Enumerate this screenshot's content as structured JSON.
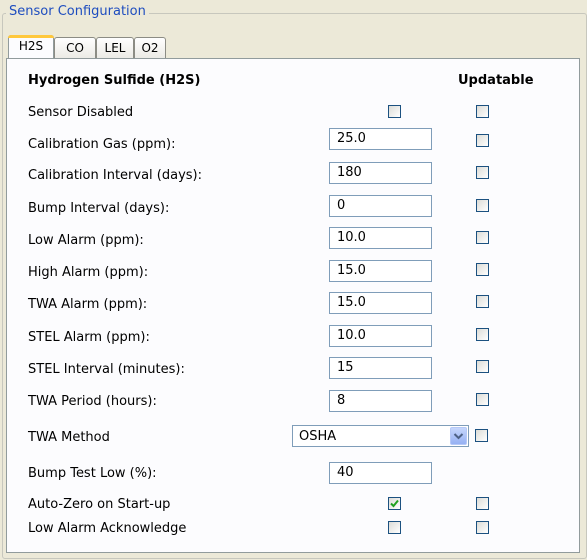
{
  "group": {
    "title": "Sensor Configuration"
  },
  "tabs": [
    "H2S",
    "CO",
    "LEL",
    "O2"
  ],
  "section": {
    "title": "Hydrogen Sulfide (H2S)",
    "updatable_header": "Updatable"
  },
  "rows": [
    {
      "label": "Sensor Disabled"
    },
    {
      "label": "Calibration Gas (ppm):",
      "value": "25.0"
    },
    {
      "label": "Calibration Interval (days):",
      "value": "180"
    },
    {
      "label": "Bump Interval (days):",
      "value": "0"
    },
    {
      "label": "Low Alarm (ppm):",
      "value": "10.0"
    },
    {
      "label": "High Alarm (ppm):",
      "value": "15.0"
    },
    {
      "label": "TWA Alarm (ppm):",
      "value": "15.0"
    },
    {
      "label": "STEL Alarm (ppm):",
      "value": "10.0"
    },
    {
      "label": "STEL Interval (minutes):",
      "value": "15"
    },
    {
      "label": "TWA Period (hours):",
      "value": "8"
    },
    {
      "label": "TWA Method",
      "value": "OSHA"
    },
    {
      "label": "Bump Test Low (%):",
      "value": "40"
    },
    {
      "label": "Auto-Zero on Start-up",
      "checked": true
    },
    {
      "label": "Low Alarm Acknowledge",
      "checked": false
    }
  ],
  "colors": {
    "accent": "#1e4dbf",
    "check": "#21a121",
    "tab_highlight": "#ffc83c"
  }
}
